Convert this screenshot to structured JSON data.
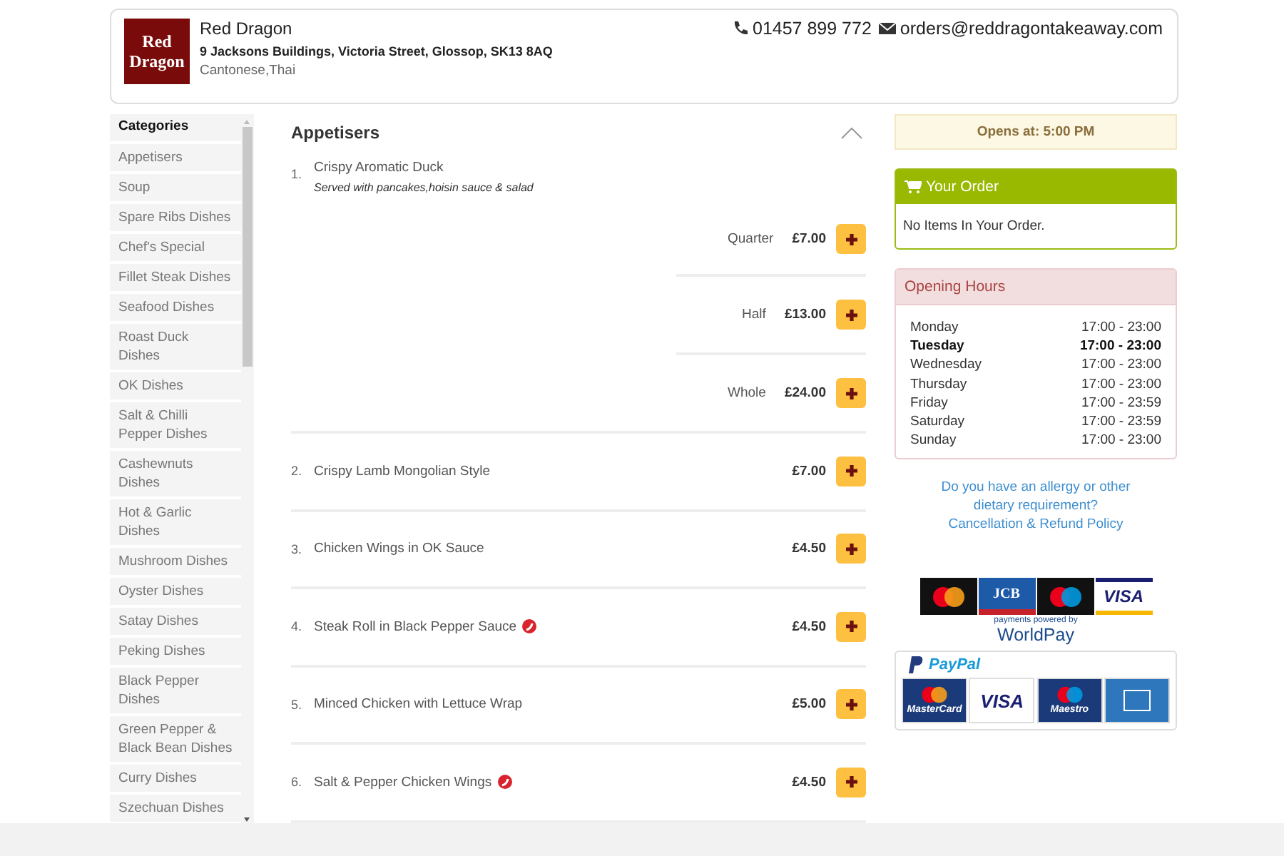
{
  "restaurant": {
    "logo_lines": [
      "Red",
      "Dragon"
    ],
    "name": "Red Dragon",
    "address": "9 Jacksons Buildings, Victoria Street, Glossop, SK13 8AQ",
    "cuisine": "Cantonese,Thai",
    "phone": "01457 899 772",
    "email": "orders@reddragontakeaway.com"
  },
  "categories": {
    "title": "Categories",
    "items": [
      {
        "label": "Appetisers"
      },
      {
        "label": "Soup"
      },
      {
        "label": "Spare Ribs Dishes"
      },
      {
        "label": "Chef's Special"
      },
      {
        "label": "Fillet Steak Dishes"
      },
      {
        "label": "Seafood Dishes"
      },
      {
        "label": "Roast Duck Dishes"
      },
      {
        "label": "OK Dishes"
      },
      {
        "label": "Salt & Chilli Pepper Dishes"
      },
      {
        "label": "Cashewnuts Dishes"
      },
      {
        "label": "Hot & Garlic Dishes"
      },
      {
        "label": "Mushroom Dishes"
      },
      {
        "label": "Oyster Dishes"
      },
      {
        "label": "Satay Dishes"
      },
      {
        "label": "Peking Dishes"
      },
      {
        "label": "Black Pepper Dishes"
      },
      {
        "label": "Green Pepper & Black Bean Dishes"
      },
      {
        "label": "Curry Dishes"
      },
      {
        "label": "Szechuan Dishes"
      }
    ]
  },
  "menu": {
    "section": "Appetisers",
    "expanded": true,
    "items": [
      {
        "number": "1.",
        "name": "Crispy Aromatic Duck",
        "description": "Served with pancakes,hoisin sauce & salad",
        "spicy": false,
        "options": [
          {
            "size": "Quarter",
            "price": "£7.00"
          },
          {
            "size": "Half",
            "price": "£13.00"
          },
          {
            "size": "Whole",
            "price": "£24.00"
          }
        ]
      },
      {
        "number": "2.",
        "name": "Crispy Lamb Mongolian Style",
        "spicy": false,
        "price": "£7.00"
      },
      {
        "number": "3.",
        "name": "Chicken Wings in OK Sauce",
        "spicy": false,
        "price": "£4.50"
      },
      {
        "number": "4.",
        "name": "Steak Roll in Black Pepper Sauce",
        "spicy": true,
        "price": "£4.50"
      },
      {
        "number": "5.",
        "name": "Minced Chicken with Lettuce Wrap",
        "spicy": false,
        "price": "£5.00"
      },
      {
        "number": "6.",
        "name": "Salt & Pepper Chicken Wings",
        "spicy": true,
        "price": "£4.50"
      }
    ]
  },
  "opening_notice": "Opens at: 5:00 PM",
  "order": {
    "title": "Your Order",
    "empty_text": "No Items In Your Order."
  },
  "opening_hours": {
    "title": "Opening Hours",
    "days": [
      {
        "day": "Monday",
        "hours": "17:00 - 23:00",
        "today": false
      },
      {
        "day": "Tuesday",
        "hours": "17:00 - 23:00",
        "today": true
      },
      {
        "day": "Wednesday",
        "hours": "17:00 - 23:00",
        "today": false
      },
      {
        "day": "Thursday",
        "hours": "17:00 - 23:00",
        "today": false
      },
      {
        "day": "Friday",
        "hours": "17:00 - 23:59",
        "today": false
      },
      {
        "day": "Saturday",
        "hours": "17:00 - 23:59",
        "today": false
      },
      {
        "day": "Sunday",
        "hours": "17:00 - 23:00",
        "today": false
      }
    ]
  },
  "links": [
    "Do you have an allergy or other dietary requirement?",
    "Cancellation & Refund Policy"
  ],
  "payments": {
    "worldpay_cards": [
      {
        "kind": "mastercard"
      },
      {
        "kind": "jcb",
        "text": "JCB"
      },
      {
        "kind": "maestro"
      },
      {
        "kind": "visa",
        "text": "VISA"
      }
    ],
    "worldpay_caption": "payments powered by",
    "worldpay_name": "WorldPay",
    "paypal_name": "PayPal",
    "paypal_cards": [
      {
        "kind": "mastercard",
        "text": "MasterCard"
      },
      {
        "kind": "visa",
        "text": "VISA"
      },
      {
        "kind": "maestro",
        "text": "Maestro"
      },
      {
        "kind": "amex"
      }
    ]
  }
}
